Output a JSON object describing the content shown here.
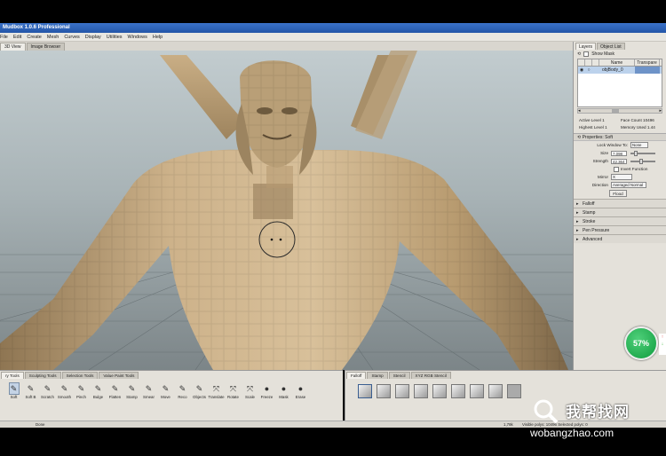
{
  "window": {
    "title": "Mudbox 1.0.6 Professional"
  },
  "menu": [
    "File",
    "Edit",
    "Create",
    "Mesh",
    "Curves",
    "Display",
    "Utilities",
    "Windows",
    "Help"
  ],
  "view_tabs": [
    "3D View",
    "Image Browser"
  ],
  "layers_panel": {
    "tabs": [
      "Layers",
      "Object List"
    ],
    "show_mask_label": "Show Mask",
    "columns": [
      "Name",
      "Transpare"
    ],
    "row_name": "objBody_0",
    "stats": {
      "active_level_label": "Active Level",
      "active_level": "1",
      "face_count_label": "Face Count",
      "face_count": "10496",
      "highest_level_label": "Highest Level",
      "highest_level": "1",
      "memory_used_label": "Memory Used",
      "memory_used": "1.44"
    }
  },
  "properties": {
    "title": "Properties: Soft",
    "lock_window_label": "Lock Window To:",
    "lock_window_value": "None",
    "size_label": "Size",
    "size_value": "7.098",
    "size_fraction": 0.15,
    "strength_label": "Strength",
    "strength_value": "42.364",
    "strength_fraction": 0.42,
    "invert_label": "Invert Function",
    "mirror_label": "Mirror",
    "mirror_value": "X",
    "direction_label": "Direction",
    "direction_value": "Averaged Normal",
    "flood_label": "Flood",
    "sections": [
      "Falloff",
      "Stamp",
      "Stroke",
      "Pen Pressure",
      "Advanced"
    ]
  },
  "tool_tray": {
    "tabs": [
      "ry Tools",
      "Sculpting Tools",
      "Selection Tools",
      "Value Paint Tools"
    ],
    "tools": [
      {
        "label": "Soft",
        "icon": "brush-icon"
      },
      {
        "label": "Soft B",
        "icon": "brush-icon"
      },
      {
        "label": "Scratch",
        "icon": "brush-icon"
      },
      {
        "label": "Smooth",
        "icon": "brush-icon"
      },
      {
        "label": "Pinch",
        "icon": "brush-icon"
      },
      {
        "label": "Bulge",
        "icon": "brush-icon"
      },
      {
        "label": "Flatten",
        "icon": "brush-icon"
      },
      {
        "label": "Stamp",
        "icon": "brush-icon"
      },
      {
        "label": "Smear",
        "icon": "brush-icon"
      },
      {
        "label": "Move",
        "icon": "brush-icon"
      },
      {
        "label": "Reco",
        "icon": "brush-icon"
      },
      {
        "label": "Objects",
        "icon": "brush-icon"
      },
      {
        "label": "Translate",
        "icon": "axes-icon"
      },
      {
        "label": "Rotate",
        "icon": "axes-icon"
      },
      {
        "label": "Scale",
        "icon": "axes-icon"
      },
      {
        "label": "Freeze",
        "icon": "sphere-icon"
      },
      {
        "label": "Mask",
        "icon": "sphere-icon"
      },
      {
        "label": "Erase",
        "icon": "sphere-icon"
      }
    ]
  },
  "falloff_tray": {
    "tabs": [
      "Falloff",
      "Stamp",
      "Stencil",
      "XYZ RGB Stencil"
    ]
  },
  "status": {
    "left": "Done",
    "right_num": "1,78k",
    "right_text": "Visible polys: 10496   Selected polys: 0"
  },
  "gauge": {
    "value": "57%",
    "up": "↑",
    "down": "↓"
  },
  "watermark": {
    "cn": "我帮找网",
    "url": "wobangzhao.com"
  },
  "colors": {
    "accent": "#2456a8",
    "skin": "#c4a77d",
    "grid_bg": "#a8b3b6",
    "gauge": "#0f9c3e"
  }
}
